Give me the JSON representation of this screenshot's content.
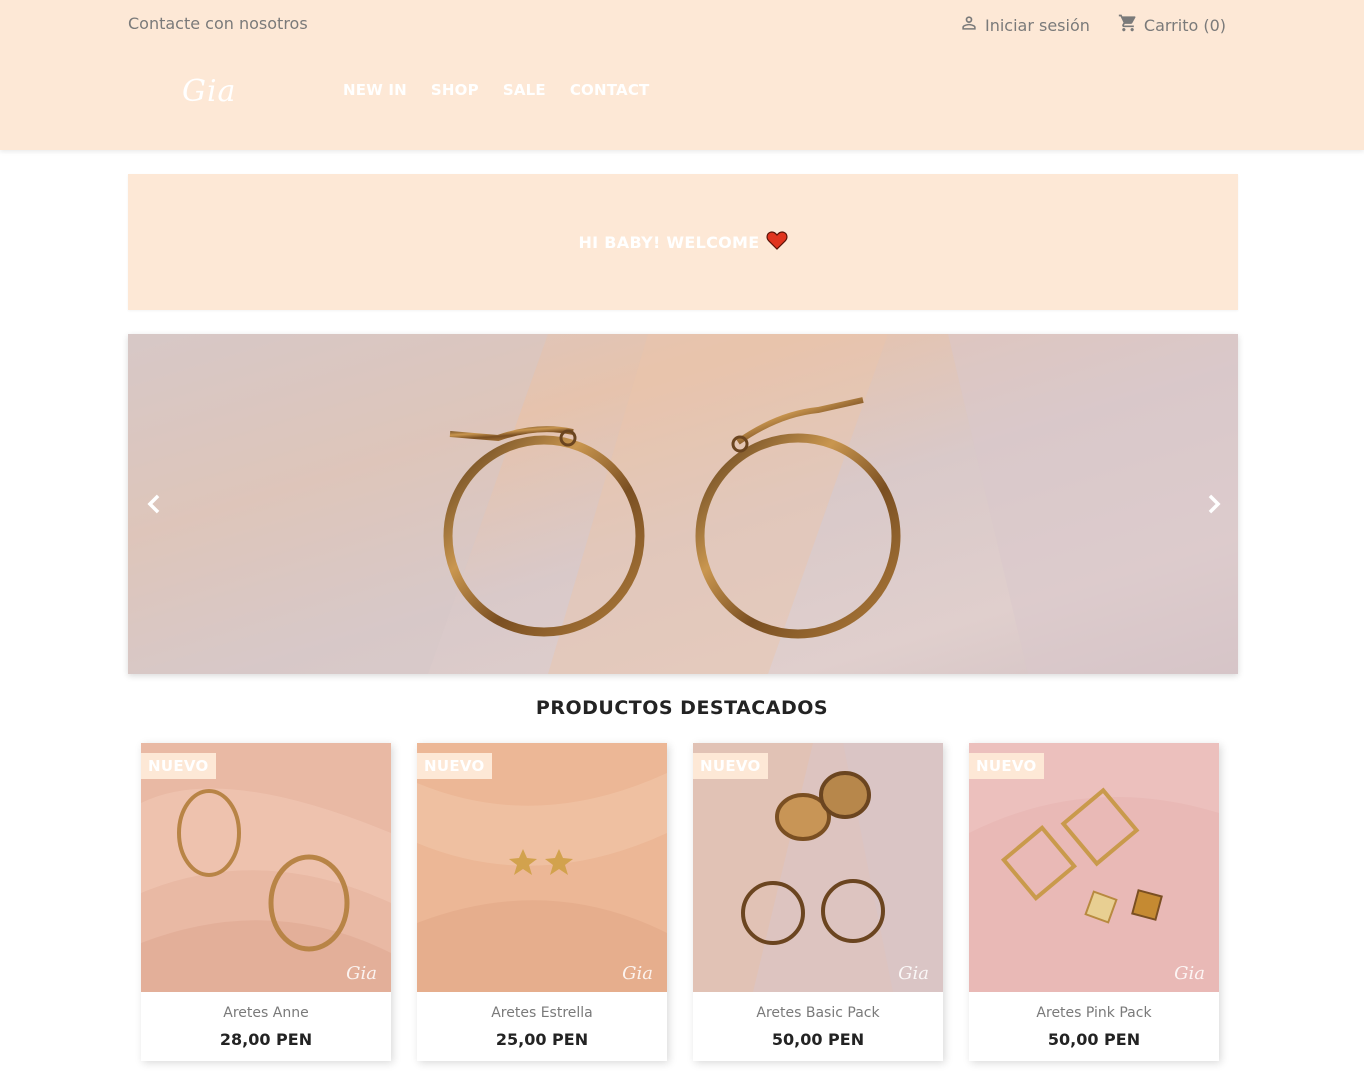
{
  "header": {
    "contact_label": "Contacte con nosotros",
    "login_label": "Iniciar sesión",
    "cart_label": "Carrito (0)",
    "logo_text": "Gia",
    "nav": [
      "NEW IN",
      "SHOP",
      "SALE",
      "CONTACT"
    ]
  },
  "banner": {
    "welcome_text": "HI BABY! WELCOME"
  },
  "featured": {
    "title": "PRODUCTOS DESTACADOS",
    "products": [
      {
        "badge": "NUEVO",
        "name": "Aretes Anne",
        "price": "28,00 PEN",
        "watermark": "Gia"
      },
      {
        "badge": "NUEVO",
        "name": "Aretes Estrella",
        "price": "25,00 PEN",
        "watermark": "Gia"
      },
      {
        "badge": "NUEVO",
        "name": "Aretes Basic Pack",
        "price": "50,00 PEN",
        "watermark": "Gia"
      },
      {
        "badge": "NUEVO",
        "name": "Aretes Pink Pack",
        "price": "50,00 PEN",
        "watermark": "Gia"
      }
    ]
  },
  "colors": {
    "header_bg": "#fde8d6",
    "heart": "#e0341e",
    "text_muted": "#7a7a7a",
    "text_dark": "#232323"
  }
}
